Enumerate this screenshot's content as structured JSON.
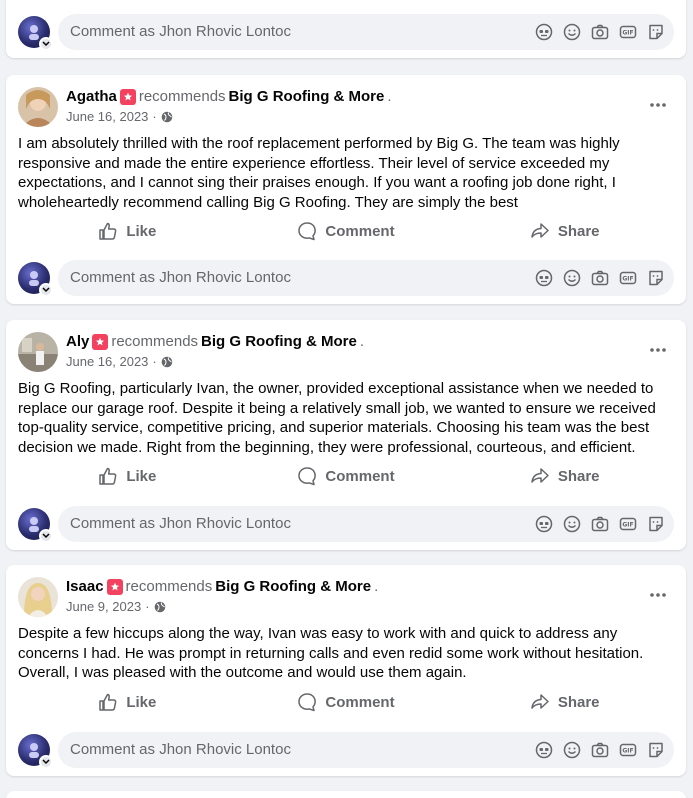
{
  "composer": {
    "placeholder": "Comment as Jhon Rhovic Lontoc",
    "tools": [
      "avatar-sticker-icon",
      "emoji-icon",
      "camera-icon",
      "gif-icon",
      "sticker-icon"
    ]
  },
  "actions": {
    "like": "Like",
    "comment": "Comment",
    "share": "Share"
  },
  "posts": [
    {
      "author": "Agatha",
      "recommends": "recommends",
      "page": "Big G Roofing & More",
      "date": "June 16, 2023",
      "sep": "·",
      "text": "I am absolutely thrilled with the roof replacement performed by Big G. The team was highly responsive and made the entire experience effortless. Their level of service exceeded my expectations, and I cannot sing their praises enough. If you want a roofing job done right, I wholeheartedly recommend calling Big G Roofing. They are simply the best"
    },
    {
      "author": "Aly",
      "recommends": "recommends",
      "page": "Big G Roofing & More",
      "date": "June 16, 2023",
      "sep": "·",
      "text": "Big G Roofing, particularly Ivan, the owner, provided exceptional assistance when we needed to replace our garage roof. Despite it being a relatively small job, we wanted to ensure we received top-quality service, competitive pricing, and superior materials. Choosing his team was the best decision we made. Right from the beginning, they were professional, courteous, and efficient."
    },
    {
      "author": "Isaac",
      "recommends": "recommends",
      "page": "Big G Roofing & More",
      "date": "June 9, 2023",
      "sep": "·",
      "text": "Despite a few hiccups along the way, Ivan was easy to work with and quick to address any concerns I had. He was prompt in returning calls and even redid some work without hesitation. Overall, I was pleased with the outcome and would use them again."
    }
  ]
}
